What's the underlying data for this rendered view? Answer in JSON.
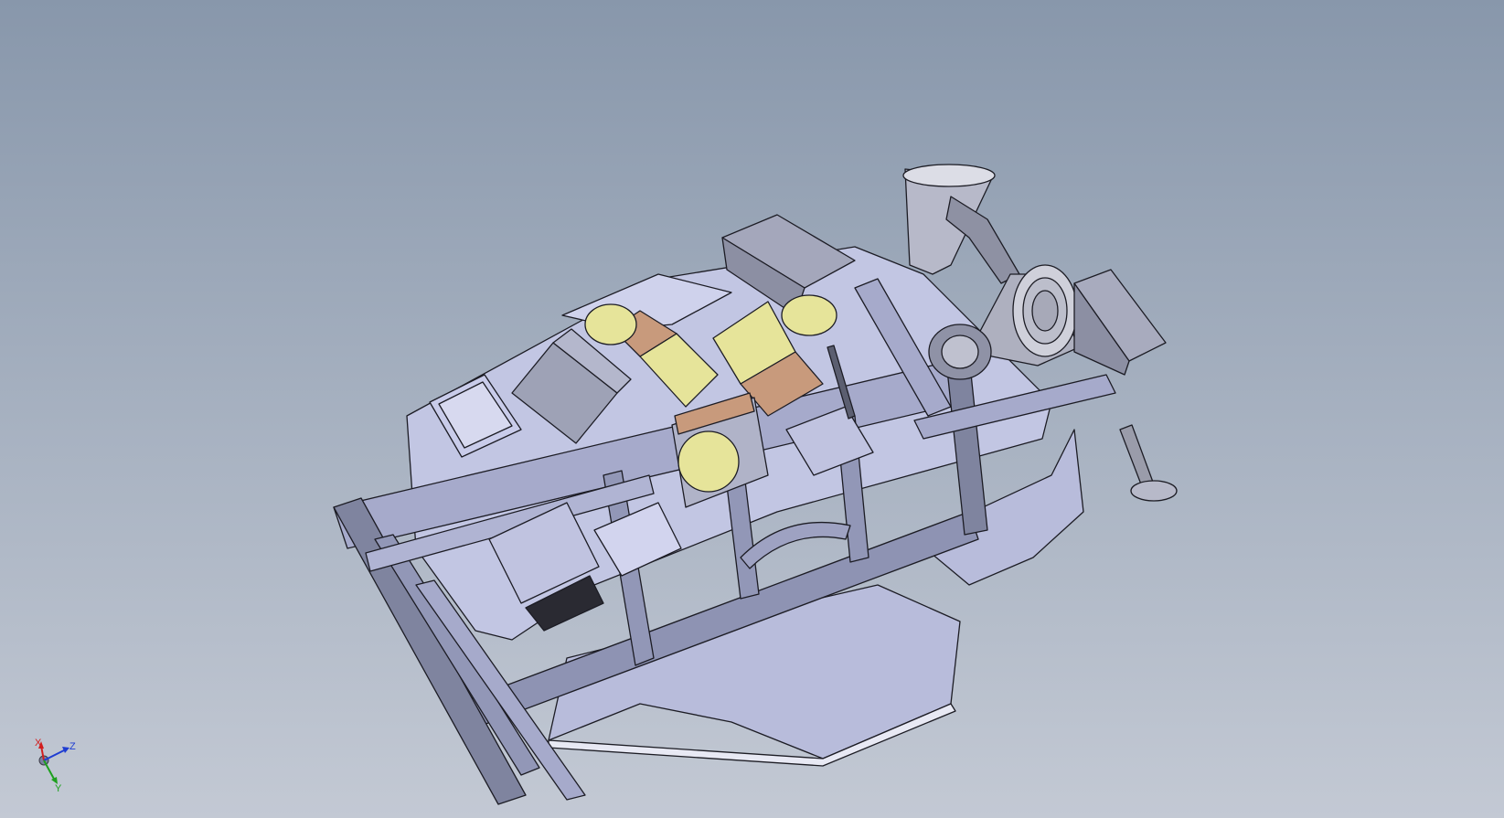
{
  "view": {
    "background_top": "#8897ab",
    "background_bottom": "#c3c9d4"
  },
  "model": {
    "palette": {
      "shaded": "#b8bcdb",
      "shaded_light": "#c9ccea",
      "shaded_dark": "#8e93b3",
      "edge": "#1c1c24",
      "yellow_part": "#e6e49a",
      "copper_part": "#c89a7c",
      "metal": "#9a9caa"
    }
  },
  "triad": {
    "x_label": "X",
    "y_label": "Y",
    "z_label": "Z",
    "x_color": "#d21e1e",
    "y_color": "#1ea01e",
    "z_color": "#1e3cd2"
  }
}
